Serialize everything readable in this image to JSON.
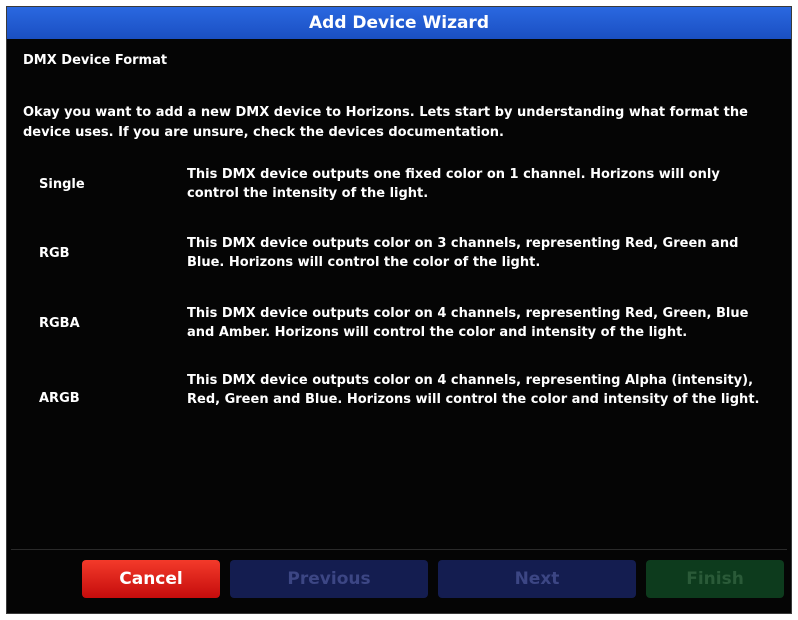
{
  "window": {
    "title": "Add Device Wizard"
  },
  "page": {
    "subtitle": "DMX Device Format",
    "intro": "Okay you want to add a new DMX device to Horizons. Lets start by understanding what format the device uses. If you are unsure, check the devices documentation."
  },
  "formats": [
    {
      "name": "Single",
      "description": "This DMX device outputs one fixed color on 1 channel. Horizons will only control the intensity of the light."
    },
    {
      "name": "RGB",
      "description": "This DMX device outputs color on 3 channels, representing Red, Green and Blue. Horizons will control the color of the light."
    },
    {
      "name": "RGBA",
      "description": "This DMX device outputs color on 4 channels, representing Red, Green, Blue and Amber. Horizons will control the color and intensity of the light."
    },
    {
      "name": "ARGB",
      "description": "This DMX device outputs color on 4 channels, representing Alpha (intensity), Red, Green and Blue. Horizons will control the color and intensity of the light."
    }
  ],
  "buttons": {
    "cancel": "Cancel",
    "previous": "Previous",
    "next": "Next",
    "finish": "Finish"
  },
  "colors": {
    "title_bar": "#1f5bd6",
    "cancel": "#e01e14",
    "nav_disabled": "#141d50",
    "finish_disabled": "#0d3b1d"
  }
}
